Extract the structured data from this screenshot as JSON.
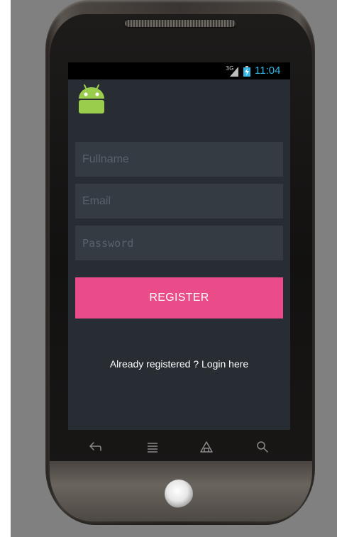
{
  "status_bar": {
    "network_label": "3G",
    "time": "11:04",
    "signal_icon": "signal-bars-icon",
    "battery_icon": "battery-charging-icon"
  },
  "app": {
    "icon": "android-icon",
    "icon_color": "#9acd4b"
  },
  "form": {
    "fullname_placeholder": "Fullname",
    "email_placeholder": "Email",
    "password_placeholder": "Password",
    "register_label": "REGISTER",
    "login_link": "Already registered ? Login here"
  },
  "colors": {
    "background": "#282d33",
    "field_background": "#353b43",
    "accent": "#ea4c89",
    "clock": "#33b5e5"
  },
  "navbar": {
    "icons": [
      "back-icon",
      "menu-icon",
      "home-icon",
      "search-icon"
    ]
  }
}
